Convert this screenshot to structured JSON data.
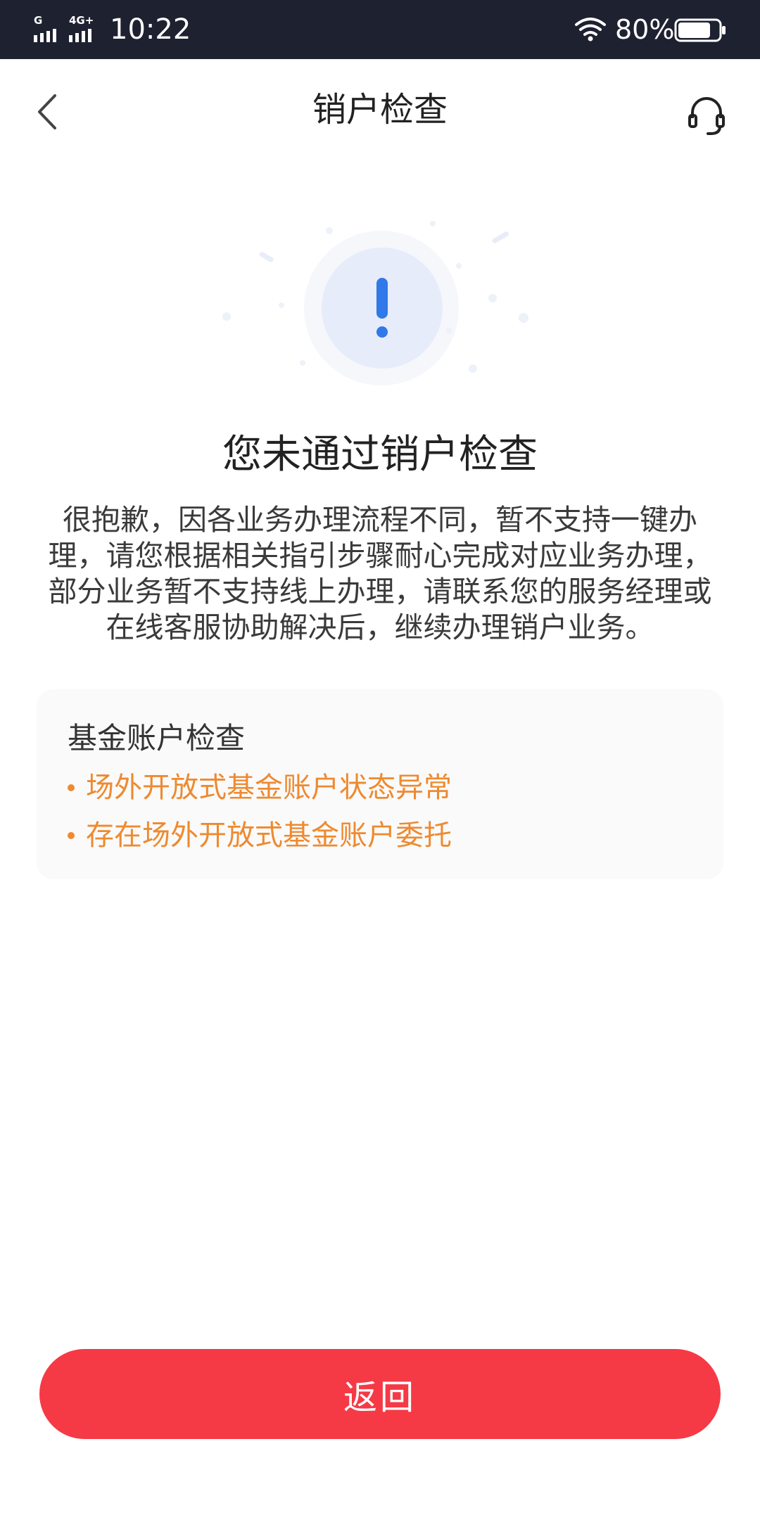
{
  "status_bar": {
    "signal_1": "G",
    "signal_2": "4G+",
    "time": "10:22",
    "battery_percent": "80%",
    "battery_level": 0.8
  },
  "nav": {
    "title": "销户检查",
    "back_icon": "chevron-left-icon",
    "service_icon": "headset-icon"
  },
  "result": {
    "icon": "exclamation-icon",
    "title": "您未通过销户检查",
    "description": "很抱歉，因各业务办理流程不同，暂不支持一键办理，请您根据相关指引步骤耐心完成对应业务办理，部分业务暂不支持线上办理，请联系您的服务经理或在线客服协助解决后，继续办理销户业务。"
  },
  "check_card": {
    "title": "基金账户检查",
    "issues": [
      "场外开放式基金账户状态异常",
      "存在场外开放式基金账户委托"
    ]
  },
  "footer": {
    "return_label": "返回"
  },
  "colors": {
    "status_bar_bg": "#1e2130",
    "accent_red": "#f53a45",
    "warning_orange": "#ee8a2f",
    "icon_blue": "#3178e8"
  }
}
